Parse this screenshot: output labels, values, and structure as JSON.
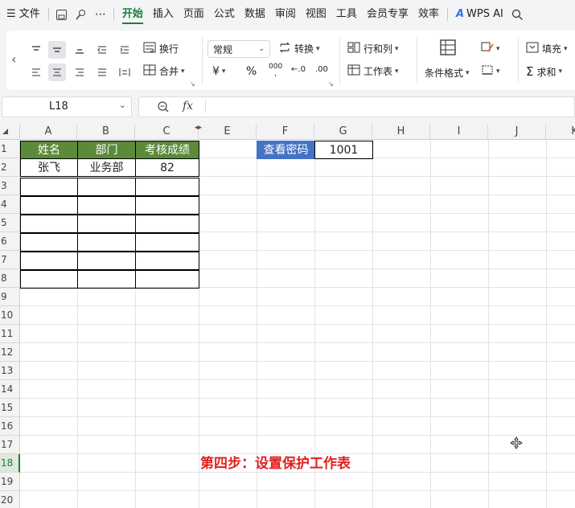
{
  "menu": {
    "items": [
      "文件",
      "开始",
      "插入",
      "页面",
      "公式",
      "数据",
      "审阅",
      "视图",
      "工具",
      "会员专享",
      "效率",
      "WPS AI"
    ]
  },
  "ribbon": {
    "wrap": "换行",
    "merge": "合并",
    "number_format": "常规",
    "convert": "转换",
    "currency": "¥",
    "percent": "%",
    "thousands": "000",
    "dec_inc": ".0",
    "rows_cols": "行和列",
    "worksheet": "工作表",
    "cond_format": "条件格式",
    "fill": "填充",
    "sum": "求和"
  },
  "name_box": {
    "value": "L18"
  },
  "formula": {
    "fx": "fx",
    "value": ""
  },
  "columns": [
    "A",
    "B",
    "C",
    "E",
    "F",
    "G",
    "H",
    "I",
    "J",
    "K"
  ],
  "rows": [
    "1",
    "2",
    "3",
    "4",
    "5",
    "6",
    "7",
    "8",
    "9",
    "10",
    "11",
    "12",
    "13",
    "14",
    "15",
    "16",
    "17",
    "18",
    "19",
    "20"
  ],
  "sheet": {
    "headers": [
      "姓名",
      "部门",
      "考核成绩"
    ],
    "row2": [
      "张飞",
      "业务部",
      "82"
    ],
    "password_label": "查看密码",
    "password_value": "1001",
    "overlay_text": "第四步：设置保护工作表"
  },
  "colors": {
    "header_green": "#5a8a3a",
    "label_blue": "#4472c4",
    "accent_green": "#1a7f3c",
    "overlay_red": "#e02020"
  }
}
